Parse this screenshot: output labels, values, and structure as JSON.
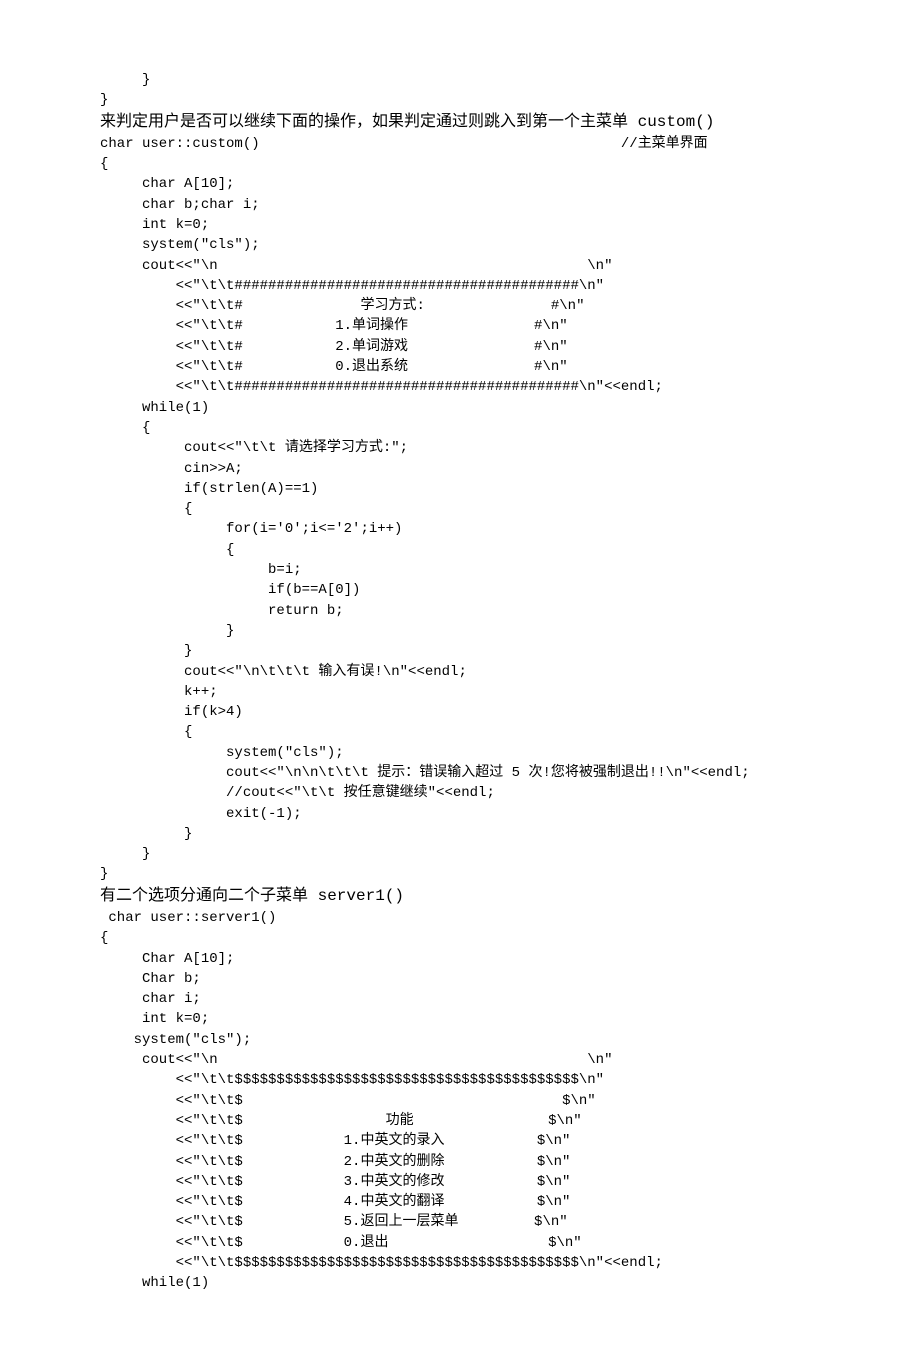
{
  "code": {
    "l01": "     }",
    "l02": "}",
    "h1": "来判定用户是否可以继续下面的操作，如果判定通过则跳入到第一个主菜单 custom()",
    "l03": "char user::custom()                                           //主菜单界面",
    "l04": "{",
    "l05": "     char A[10];",
    "l06": "     char b;char i;",
    "l07": "     int k=0;",
    "l08": "     system(\"cls\");",
    "l09": "     cout<<\"\\n                                            \\n\"",
    "l10": "         <<\"\\t\\t#########################################\\n\"",
    "l11": "         <<\"\\t\\t#              学习方式:               #\\n\"",
    "l12": "         <<\"\\t\\t#           1.单词操作               #\\n\"",
    "l13": "         <<\"\\t\\t#           2.单词游戏               #\\n\"",
    "l14": "         <<\"\\t\\t#           0.退出系统               #\\n\"",
    "l15": "         <<\"\\t\\t#########################################\\n\"<<endl;",
    "l16": "     while(1)",
    "l17": "     {",
    "l18": "          cout<<\"\\t\\t 请选择学习方式:\";",
    "l19": "          cin>>A;",
    "l20": "          if(strlen(A)==1)",
    "l21": "          {",
    "l22": "               for(i='0';i<='2';i++)",
    "l23": "               {",
    "l24": "                    b=i;",
    "l25": "                    if(b==A[0])",
    "l26": "                    return b;",
    "l27": "               }",
    "l28": "          }",
    "l29": "          cout<<\"\\n\\t\\t\\t 输入有误!\\n\"<<endl;",
    "l30": "          k++;",
    "l31": "          if(k>4)",
    "l32": "          {",
    "l33": "               system(\"cls\");",
    "l34": "               cout<<\"\\n\\n\\t\\t\\t 提示：错误输入超过 5 次!您将被强制退出!!\\n\"<<endl;",
    "l35": "               //cout<<\"\\t\\t 按任意键继续\"<<endl;",
    "l36": "               exit(-1);",
    "l37": "          }",
    "l38": "",
    "l39": "     }",
    "l40": "",
    "l41": "}",
    "h2": "有二个选项分通向二个子菜单 server1()",
    "l42": " char user::server1()",
    "l43": "{",
    "l44": "     Char A[10];",
    "l45": "     Char b;",
    "l46": "     char i;",
    "l47": "     int k=0;",
    "l48": "    system(\"cls\");",
    "l49": "     cout<<\"\\n                                            \\n\"",
    "l50": "         <<\"\\t\\t$$$$$$$$$$$$$$$$$$$$$$$$$$$$$$$$$$$$$$$$$\\n\"",
    "l51": "         <<\"\\t\\t$                                      $\\n\"",
    "l52": "         <<\"\\t\\t$                 功能                $\\n\"",
    "l53": "         <<\"\\t\\t$            1.中英文的录入           $\\n\"",
    "l54": "         <<\"\\t\\t$            2.中英文的删除           $\\n\"",
    "l55": "         <<\"\\t\\t$            3.中英文的修改           $\\n\"",
    "l56": "         <<\"\\t\\t$            4.中英文的翻译           $\\n\"",
    "l57": "         <<\"\\t\\t$            5.返回上一层菜单         $\\n\"",
    "l58": "         <<\"\\t\\t$            0.退出                   $\\n\"",
    "l59": "         <<\"\\t\\t$$$$$$$$$$$$$$$$$$$$$$$$$$$$$$$$$$$$$$$$$\\n\"<<endl;",
    "l60": "     while(1)"
  }
}
